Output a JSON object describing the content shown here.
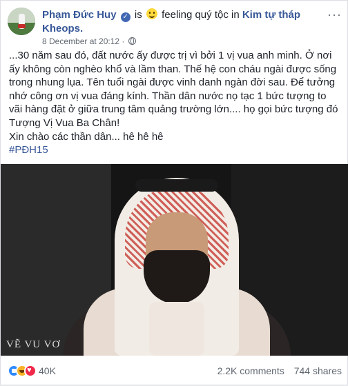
{
  "post": {
    "author": "Phạm Đức Huy",
    "activity_is": "is",
    "activity_feeling": "feeling quý tộc in",
    "location": "Kim tự tháp Kheops.",
    "timestamp": "8 December at 20:12 ·",
    "body_lines": [
      "...30 năm sau đó, đất nước ấy được trị vì bởi 1 vị vua anh minh. Ở nơi ấy không còn nghèo khổ và lầm than. Thế hệ con cháu ngài được sống trong nhung lụa. Tên tuổi ngài được vinh danh ngàn đời sau. Để tưởng nhớ công ơn vị vua đáng kính. Thần dân nước nọ tạc 1 bức tượng to vãi hàng đặt ở giữa trung tâm quảng trường lớn.... họ gọi bức tượng đó Tượng Vị Vua Ba Chân!",
      "Xin chào các thần dân... hê hê hê"
    ],
    "hashtag": "#PĐH15",
    "photo_watermark": "VẼ VU VƠ"
  },
  "footer": {
    "reactions_count": "40K",
    "comments": "2.2K comments",
    "shares": "744 shares"
  },
  "colors": {
    "link": "#385898",
    "text": "#1d2129",
    "muted": "#606770"
  }
}
